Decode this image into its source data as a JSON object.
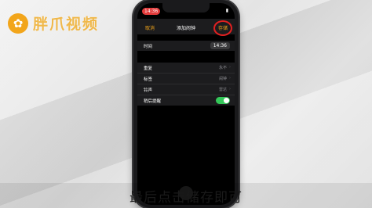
{
  "watermark": {
    "icon": "paw-icon",
    "text": "胖爪视频",
    "color": "#f0b84a"
  },
  "status_bar": {
    "time": "14:36"
  },
  "nav": {
    "cancel": "取消",
    "title": "添加闹钟",
    "save": "存储",
    "accent": "#f2a51a"
  },
  "time_row": {
    "label": "时间",
    "value": "14:36"
  },
  "settings": [
    {
      "label": "重复",
      "value": "永不"
    },
    {
      "label": "标签",
      "value": "闹钟"
    },
    {
      "label": "铃声",
      "value": "雷达"
    },
    {
      "label": "稍后提醒",
      "toggle": true
    }
  ],
  "caption": "最后点击储存即可",
  "highlight_color": "#e02020"
}
